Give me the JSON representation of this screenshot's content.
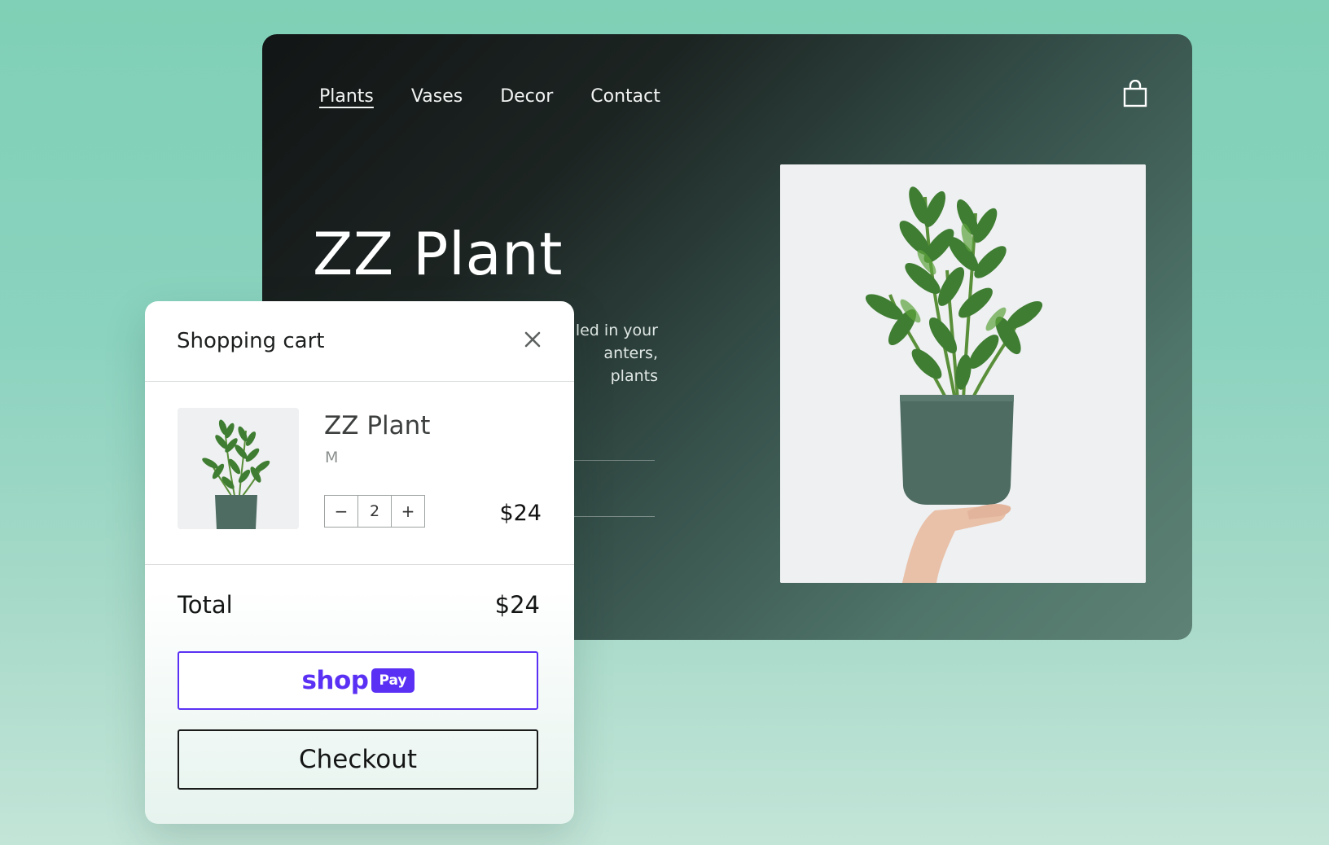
{
  "store": {
    "nav": [
      {
        "label": "Plants",
        "active": true
      },
      {
        "label": "Vases",
        "active": false
      },
      {
        "label": "Decor",
        "active": false
      },
      {
        "label": "Contact",
        "active": false
      }
    ],
    "cart_icon": "shopping-bag-icon",
    "hero": {
      "title": "ZZ Plant",
      "description_lines": [
        "led in your",
        "anters,",
        "plants"
      ]
    },
    "product_image": "zz-plant-photo"
  },
  "cart": {
    "title": "Shopping cart",
    "close_icon": "close-icon",
    "item": {
      "name": "ZZ Plant",
      "variant": "M",
      "quantity": "2",
      "decrement_label": "−",
      "increment_label": "+",
      "price": "$24"
    },
    "total_label": "Total",
    "total_value": "$24",
    "shoppay": {
      "shop": "shop",
      "pay": "Pay"
    },
    "checkout_label": "Checkout"
  },
  "colors": {
    "background": "#8bd3bf",
    "shoppay_purple": "#5a31f4",
    "plant_green": "#3f7d32",
    "pot_green": "#4e6c62"
  }
}
